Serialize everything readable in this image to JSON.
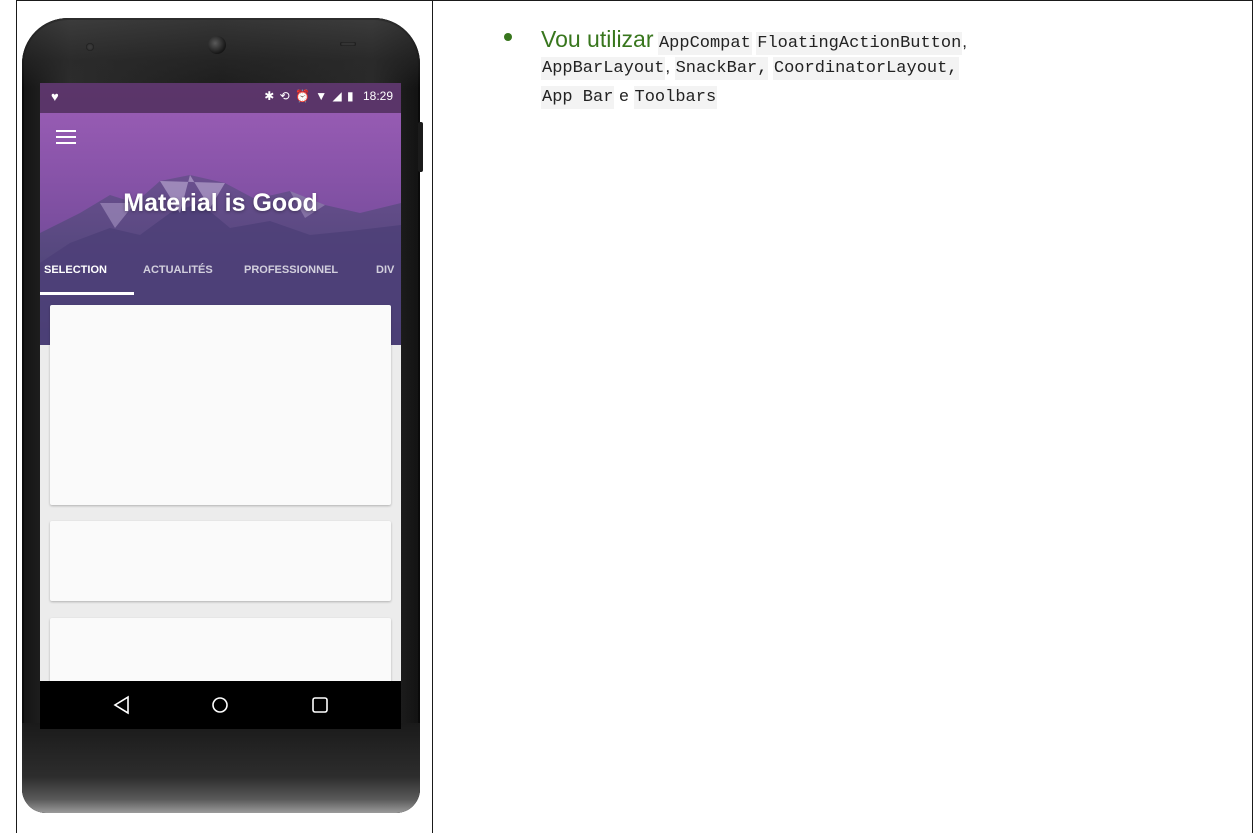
{
  "phone": {
    "status_time": "18:29",
    "status_icons": "✱ ⟲ ⏰ ▼ ◢ ▮",
    "app_title": "Material is Good",
    "tabs": [
      "SELECTION",
      "ACTUALITÉS",
      "PROFESSIONNEL",
      "DIV"
    ],
    "active_tab": 0,
    "header_color": "#9d5fb7",
    "nav_icons": [
      "back-icon",
      "home-icon",
      "recents-icon"
    ]
  },
  "note": {
    "lead": "Vou utilizar",
    "items": [
      {
        "text": "AppCompat",
        "code": true
      },
      {
        "text": "FloatingActionButton",
        "code": true
      },
      {
        "text": ",",
        "code": false
      },
      {
        "text": "AppBarLayout",
        "code": true
      },
      {
        "text": ",",
        "code": false
      },
      {
        "text": "SnackBar,",
        "code": true
      },
      {
        "text": "CoordinatorLayout,",
        "code": true
      },
      {
        "text": "App Bar",
        "code": true
      },
      {
        "text": "e",
        "code": true
      },
      {
        "text": "Toolbars",
        "code": true
      }
    ],
    "bullet_color": "#38761d"
  }
}
